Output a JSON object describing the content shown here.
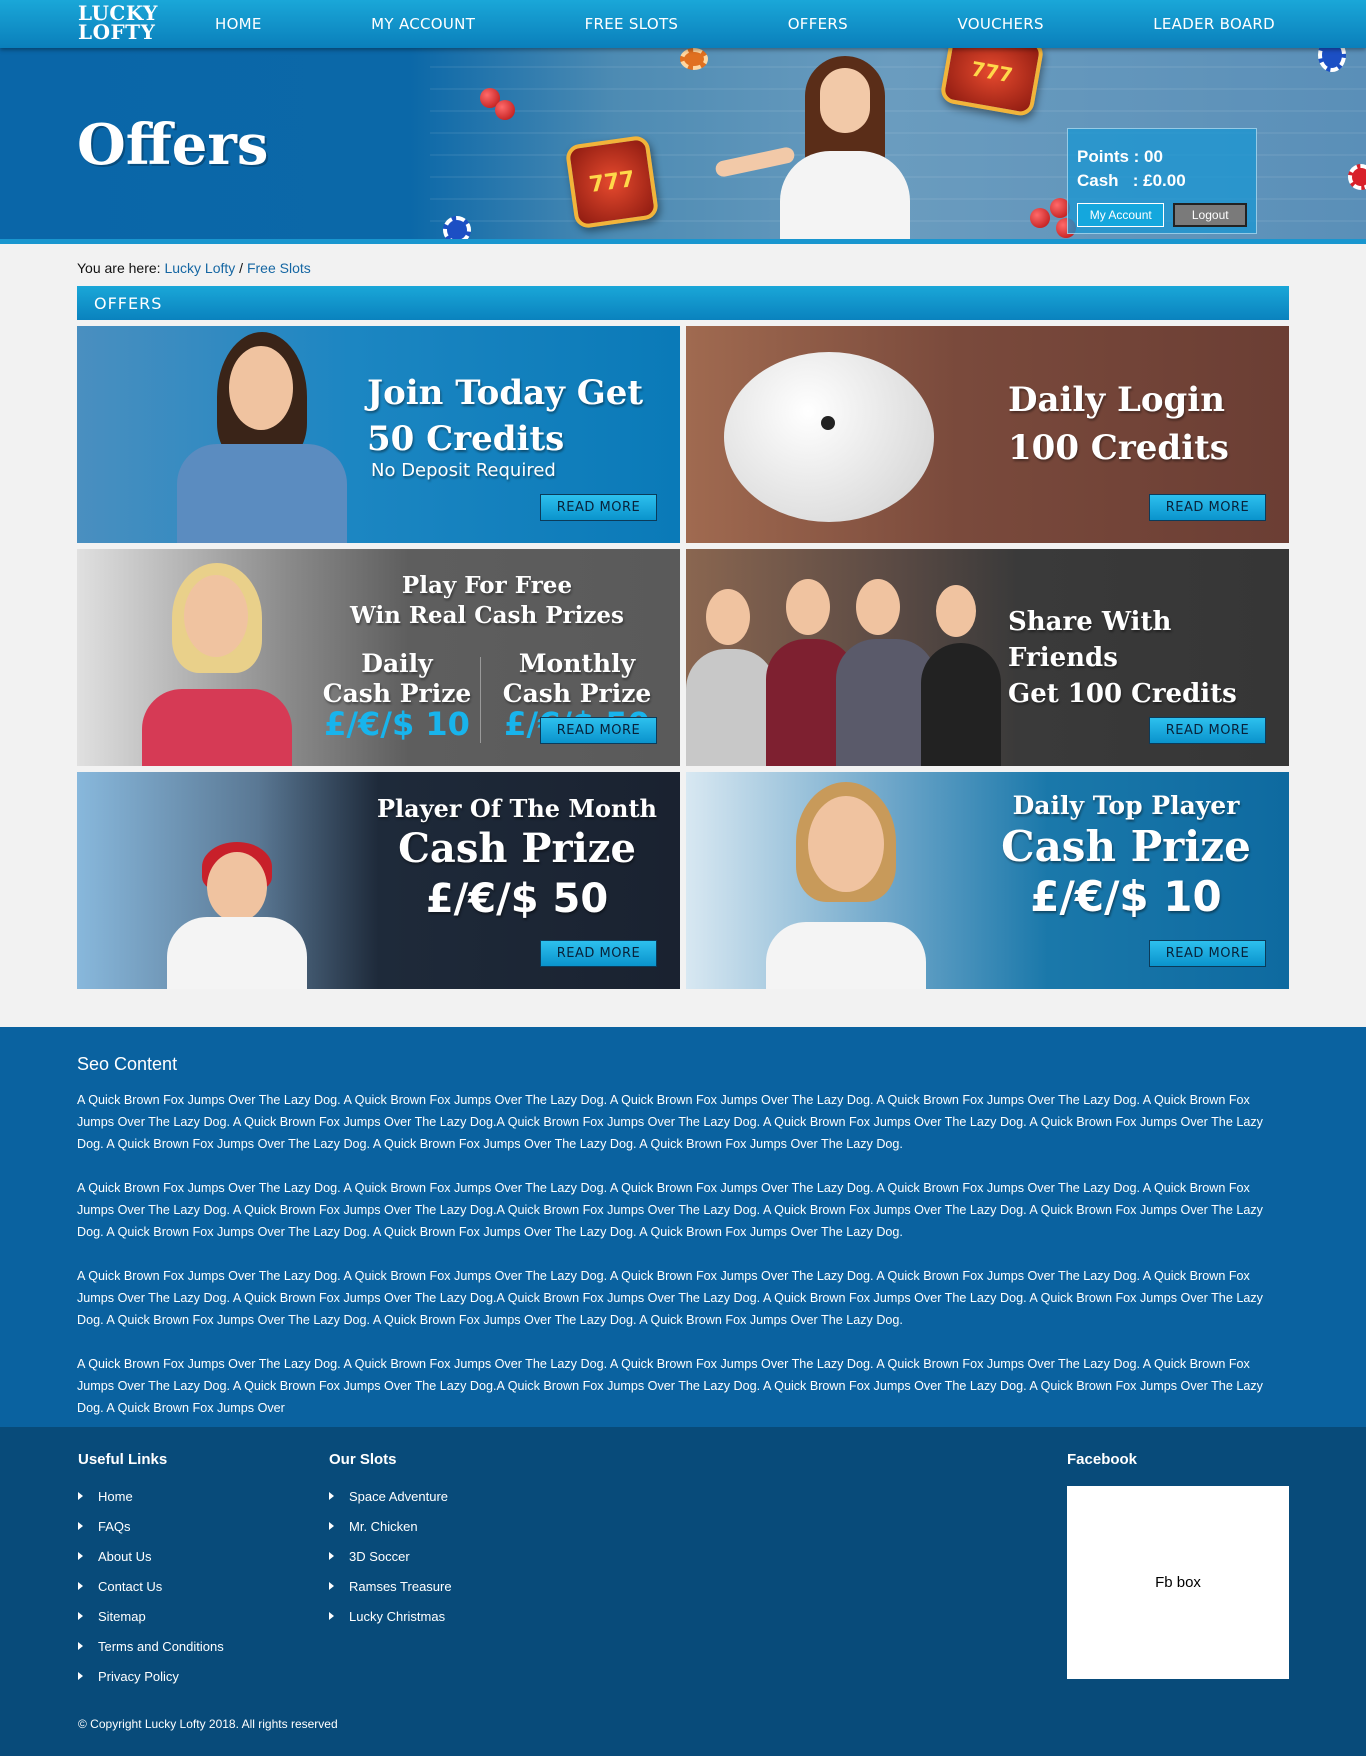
{
  "brand": {
    "logo_line1": "LUCKY",
    "logo_line2": "LOFTY"
  },
  "nav": {
    "items": [
      "HOME",
      "MY ACCOUNT",
      "FREE SLOTS",
      "OFFERS",
      "VOUCHERS",
      "LEADER BOARD"
    ]
  },
  "hero": {
    "title": "Offers",
    "slot_text": "777",
    "account": {
      "points_line": "Points : 00",
      "cash_line": "Cash   : £0.00",
      "my_account_label": "My Account",
      "logout_label": "Logout"
    }
  },
  "breadcrumb": {
    "prefix": "You are here:",
    "home": "Lucky Lofty",
    "separator": "/",
    "current": "Free Slots"
  },
  "section_title": "OFFERS",
  "offers": [
    {
      "line1": "Join Today Get",
      "line2": "50 Credits",
      "sub": "No Deposit Required",
      "button": "READ MORE"
    },
    {
      "line1": "Daily Login",
      "line2": "100 Credits",
      "button": "READ MORE"
    },
    {
      "line1": "Play For Free",
      "line2": "Win Real Cash Prizes",
      "col1_title1": "Daily",
      "col1_title2": "Cash Prize",
      "col1_amount": "£/€/$ 10",
      "col2_title1": "Monthly",
      "col2_title2": "Cash Prize",
      "col2_amount": "£/€/$ 50",
      "button": "READ MORE"
    },
    {
      "line1": "Share With Friends",
      "line2": "Get 100 Credits",
      "button": "READ MORE"
    },
    {
      "line1": "Player Of The Month",
      "line2": "Cash Prize",
      "line3": "£/€/$ 50",
      "button": "READ MORE"
    },
    {
      "line1": "Daily Top Player",
      "line2": "Cash Prize",
      "line3": "£/€/$ 10",
      "button": "READ MORE"
    }
  ],
  "seo": {
    "title": "Seo Content",
    "paragraphs": [
      "A Quick Brown Fox Jumps Over The Lazy Dog. A Quick Brown Fox Jumps Over The Lazy Dog. A Quick Brown Fox Jumps Over The Lazy Dog. A Quick Brown Fox Jumps Over The Lazy Dog. A Quick Brown Fox Jumps Over The Lazy Dog. A Quick Brown Fox Jumps Over The Lazy Dog.A Quick Brown Fox Jumps Over The Lazy Dog. A Quick Brown Fox Jumps Over The Lazy Dog. A Quick Brown Fox Jumps Over The Lazy Dog. A Quick Brown Fox Jumps Over The Lazy Dog. A Quick Brown Fox Jumps Over The Lazy Dog. A Quick Brown Fox Jumps Over The Lazy Dog.",
      "A Quick Brown Fox Jumps Over The Lazy Dog. A Quick Brown Fox Jumps Over The Lazy Dog. A Quick Brown Fox Jumps Over The Lazy Dog. A Quick Brown Fox Jumps Over The Lazy Dog. A Quick Brown Fox Jumps Over The Lazy Dog. A Quick Brown Fox Jumps Over The Lazy Dog.A Quick Brown Fox Jumps Over The Lazy Dog. A Quick Brown Fox Jumps Over The Lazy Dog. A Quick Brown Fox Jumps Over The Lazy Dog. A Quick Brown Fox Jumps Over The Lazy Dog. A Quick Brown Fox Jumps Over The Lazy Dog. A Quick Brown Fox Jumps Over The Lazy Dog.",
      "A Quick Brown Fox Jumps Over The Lazy Dog. A Quick Brown Fox Jumps Over The Lazy Dog. A Quick Brown Fox Jumps Over The Lazy Dog. A Quick Brown Fox Jumps Over The Lazy Dog. A Quick Brown Fox Jumps Over The Lazy Dog. A Quick Brown Fox Jumps Over The Lazy Dog.A Quick Brown Fox Jumps Over The Lazy Dog. A Quick Brown Fox Jumps Over The Lazy Dog. A Quick Brown Fox Jumps Over The Lazy Dog. A Quick Brown Fox Jumps Over The Lazy Dog. A Quick Brown Fox Jumps Over The Lazy Dog. A Quick Brown Fox Jumps Over The Lazy Dog.",
      "A Quick Brown Fox Jumps Over The Lazy Dog. A Quick Brown Fox Jumps Over The Lazy Dog. A Quick Brown Fox Jumps Over The Lazy Dog. A Quick Brown Fox Jumps Over The Lazy Dog. A Quick Brown Fox Jumps Over The Lazy Dog. A Quick Brown Fox Jumps Over The Lazy Dog.A Quick Brown Fox Jumps Over The Lazy Dog. A Quick Brown Fox Jumps Over The Lazy Dog. A Quick Brown Fox Jumps Over The Lazy Dog. A Quick Brown Fox Jumps Over"
    ]
  },
  "footer": {
    "useful_links_title": "Useful Links",
    "useful_links": [
      "Home",
      "FAQs",
      "About Us",
      "Contact Us",
      "Sitemap",
      "Terms and Conditions",
      "Privacy Policy"
    ],
    "slots_title": "Our Slots",
    "slots": [
      "Space Adventure",
      "Mr. Chicken",
      "3D Soccer",
      "Ramses Treasure",
      "Lucky Christmas"
    ],
    "facebook_title": "Facebook",
    "fb_box": "Fb box",
    "copyright": "© Copyright Lucky Lofty 2018. All rights reserved"
  }
}
